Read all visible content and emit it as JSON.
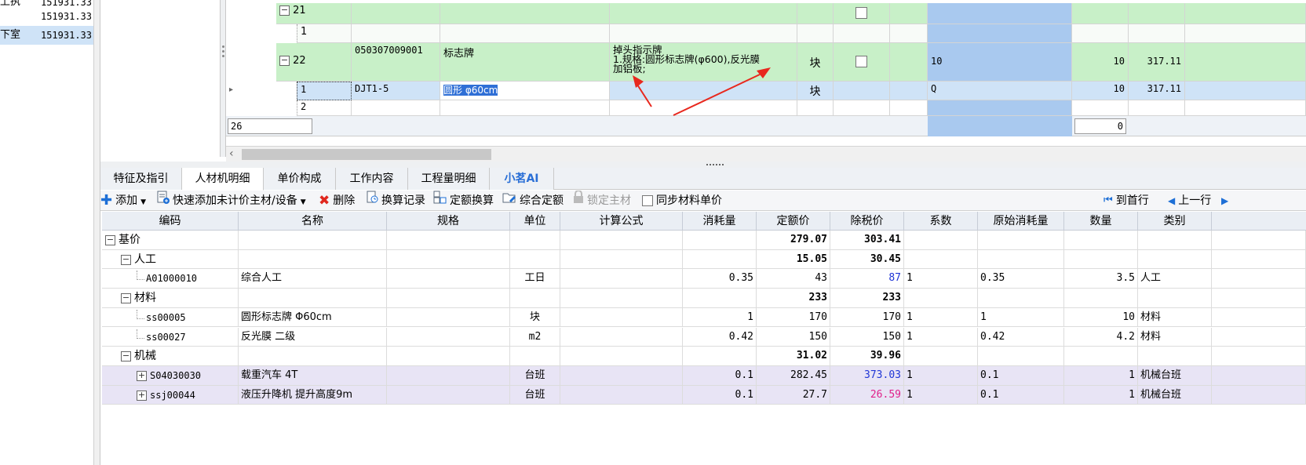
{
  "left_tree": {
    "rows": [
      {
        "name": "上执",
        "value": "151931.33"
      },
      {
        "name": "",
        "value": "151931.33"
      },
      {
        "name": "下室",
        "value": "151931.33",
        "selected": true
      }
    ]
  },
  "top_grid": {
    "rows": [
      {
        "seq": "21",
        "type": "group"
      },
      {
        "seq": "1",
        "type": "child"
      },
      {
        "seq": "22",
        "type": "group",
        "code": "050307009001",
        "name": "标志牌",
        "feature_lines": [
          "掉头指示牌",
          "1.规格:圆形标志牌(φ600),反光膜",
          "加铝板;"
        ],
        "unit": "块",
        "qty1": "10",
        "qty2": "10",
        "price": "317.11"
      },
      {
        "seq": "1",
        "type": "child-selected",
        "code": "DJT1-5",
        "name": "圆形 φ60cm",
        "unit": "块",
        "qty1": "Q",
        "qty2": "10",
        "price": "317.11"
      },
      {
        "seq": "2",
        "type": "child"
      }
    ],
    "summary": {
      "count_input": "26",
      "total_input": "0"
    }
  },
  "tabs": [
    {
      "label": "特征及指引"
    },
    {
      "label": "人材机明细",
      "active": true
    },
    {
      "label": "单价构成"
    },
    {
      "label": "工作内容"
    },
    {
      "label": "工程量明细"
    },
    {
      "label": "小茗AI",
      "ai": true
    }
  ],
  "toolbar": {
    "add": "添加",
    "quick_add": "快速添加未计价主材/设备",
    "delete": "删除",
    "conversion_log": "换算记录",
    "quota_conversion": "定额换算",
    "composite_quota": "综合定额",
    "lock_main_material": "锁定主材",
    "sync_price": "同步材料单价",
    "first_row": "到首行",
    "prev_row": "上一行"
  },
  "detail_grid": {
    "columns": [
      "编码",
      "名称",
      "规格",
      "单位",
      "计算公式",
      "消耗量",
      "定额价",
      "除税价",
      "系数",
      "原始消耗量",
      "数量",
      "类别"
    ],
    "rows": [
      {
        "level": 0,
        "code": "基价",
        "quota_price": "279.07",
        "tax_ex_price": "303.41",
        "kind": "group"
      },
      {
        "level": 1,
        "code": "人工",
        "quota_price": "15.05",
        "tax_ex_price": "30.45",
        "kind": "group"
      },
      {
        "level": 2,
        "code": "A01000010",
        "name": "综合人工",
        "unit": "工日",
        "consumption": "0.35",
        "quota_price": "43",
        "tax_ex_price": "87",
        "tax_color": "blue",
        "coef": "1",
        "orig": "0.35",
        "qty": "3.5",
        "category": "人工",
        "kind": "leaf"
      },
      {
        "level": 1,
        "code": "材料",
        "quota_price": "233",
        "tax_ex_price": "233",
        "kind": "group"
      },
      {
        "level": 2,
        "code": "ss00005",
        "name": "圆形标志牌 Φ60cm",
        "unit": "块",
        "consumption": "1",
        "quota_price": "170",
        "tax_ex_price": "170",
        "coef": "1",
        "orig": "1",
        "qty": "10",
        "category": "材料",
        "kind": "leaf"
      },
      {
        "level": 2,
        "code": "ss00027",
        "name": "反光膜  二级",
        "unit": "m2",
        "consumption": "0.42",
        "quota_price": "150",
        "tax_ex_price": "150",
        "coef": "1",
        "orig": "0.42",
        "qty": "4.2",
        "category": "材料",
        "kind": "leaf"
      },
      {
        "level": 1,
        "code": "机械",
        "quota_price": "31.02",
        "tax_ex_price": "39.96",
        "kind": "group"
      },
      {
        "level": 2,
        "code": "S04030030",
        "name": "载重汽车 4T",
        "unit": "台班",
        "consumption": "0.1",
        "quota_price": "282.45",
        "tax_ex_price": "373.03",
        "tax_color": "blue",
        "coef": "1",
        "orig": "0.1",
        "qty": "1",
        "category": "机械台班",
        "kind": "machine"
      },
      {
        "level": 2,
        "code": "ssj00044",
        "name": "液压升降机 提升高度9m",
        "unit": "台班",
        "consumption": "0.1",
        "quota_price": "27.7",
        "tax_ex_price": "26.59",
        "tax_color": "pink",
        "coef": "1",
        "orig": "0.1",
        "qty": "1",
        "category": "机械台班",
        "kind": "machine"
      }
    ]
  },
  "colors": {
    "green_row": "#c8f0c8",
    "selected_row": "#cfe3f7",
    "highlight_col": "#a9c9ef",
    "arrow_red": "#e8281e",
    "machine_row": "#e8e4f5"
  }
}
